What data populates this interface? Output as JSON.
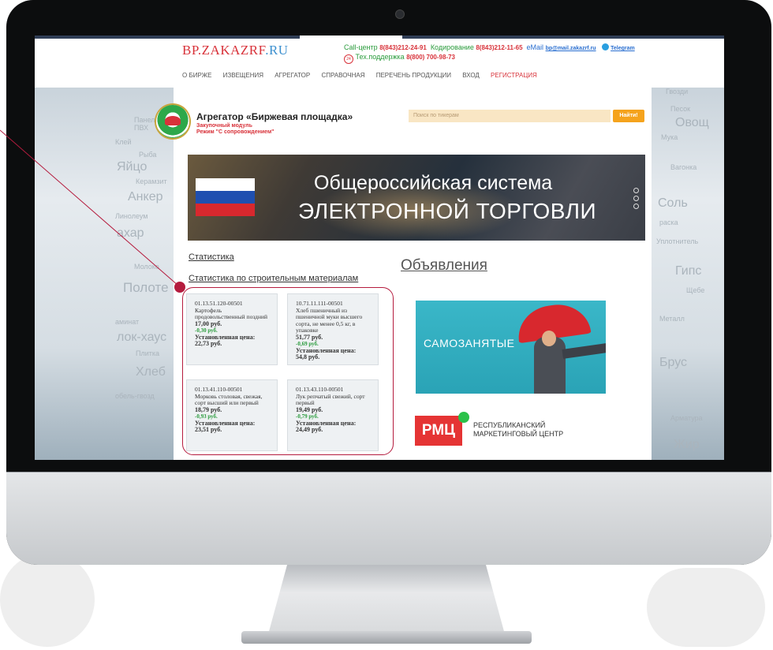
{
  "header": {
    "logo_main": "BP.ZAKAZRF",
    "logo_suffix": ".RU",
    "callcenter_label": "Call-центр",
    "callcenter_phone": "8(843)212-24-91",
    "coding_label": "Кодирование",
    "coding_phone": "8(843)212-11-65",
    "email_label": "eMail",
    "email_value": "bp@mail.zakazrf.ru",
    "telegram_label": "Telegram",
    "support_label": "Тех.поддержка",
    "support_phone": "8(800) 700-98-73"
  },
  "nav": {
    "items": [
      "О БИРЖЕ",
      "ИЗВЕЩЕНИЯ",
      "АГРЕГАТОР",
      "СПРАВОЧНАЯ",
      "ПЕРЕЧЕНЬ ПРОДУКЦИИ",
      "ВХОД"
    ],
    "register": "РЕГИСТРАЦИЯ"
  },
  "aggregator": {
    "title": "Агрегатор «Биржевая площадка»",
    "sub1": "Закупочный модуль",
    "sub2": "Режим \"С сопровождением\""
  },
  "search": {
    "placeholder": "Поиск по тикерам",
    "button": "Найти!"
  },
  "banner": {
    "line1": "Общероссийская система",
    "line2": "ЭЛЕКТРОННОЙ ТОРГОВЛИ"
  },
  "links": {
    "stats": "Статистика",
    "stats_building": "Статистика по строительным материалам",
    "announcements": "Объявления"
  },
  "cards": [
    {
      "code": "01.13.51.120-00501",
      "name": "Картофель продовольственный поздний",
      "price": "17,00 руб.",
      "change": "-0,30 руб.",
      "est_label": "Установленная цена:",
      "est_price": "22,73 руб."
    },
    {
      "code": "10.71.11.111-00501",
      "name": "Хлеб пшеничный из пшеничной муки высшего сорта, не менее 0,5 кг, в упаковке",
      "price": "51,77 руб.",
      "change": "-0,69 руб.",
      "est_label": "Установленная цена:",
      "est_price": "54,8 руб."
    },
    {
      "code": "01.13.41.110-00501",
      "name": "Морковь столовая, свежая, сорт высший или первый",
      "price": "18,79 руб.",
      "change": "-0,93 руб.",
      "est_label": "Установленная цена:",
      "est_price": "23,51 руб."
    },
    {
      "code": "01.13.43.110-00501",
      "name": "Лук репчатый свежий, сорт первый",
      "price": "19,49 руб.",
      "change": "-0,79 руб.",
      "est_label": "Установленная цена:",
      "est_price": "24,49 руб."
    }
  ],
  "ads": {
    "self_employed": "САМОЗАНЯТЫЕ",
    "rmc_logo": "РМЦ",
    "rmc_line1": "РЕСПУБЛИКАНСКИЙ",
    "rmc_line2": "МАРКЕТИНГОВЫЙ ЦЕНТР"
  },
  "background_words": {
    "left": [
      "Панель",
      "ПВХ",
      "Клей",
      "Рыба",
      "Яйцо",
      "Керамзит",
      "Анкер",
      "Линолеум",
      "ахар",
      "Молоко",
      "Полоте",
      "аминат",
      "лок-хаус",
      "Плитка",
      "Хлеб",
      "обель-гвозд"
    ],
    "right": [
      "Гвозди",
      "Песок",
      "Овощ",
      "Мука",
      "Вагонка",
      "Соль",
      "раска",
      "Уплотнитель",
      "Гипс",
      "Щебе",
      "Металл",
      "Брус",
      "Арматура",
      "Жир"
    ]
  },
  "colors": {
    "accent_red": "#d8323a",
    "accent_green": "#2a9b3c",
    "highlight": "#b51c3e",
    "button_orange": "#f5a31d"
  }
}
